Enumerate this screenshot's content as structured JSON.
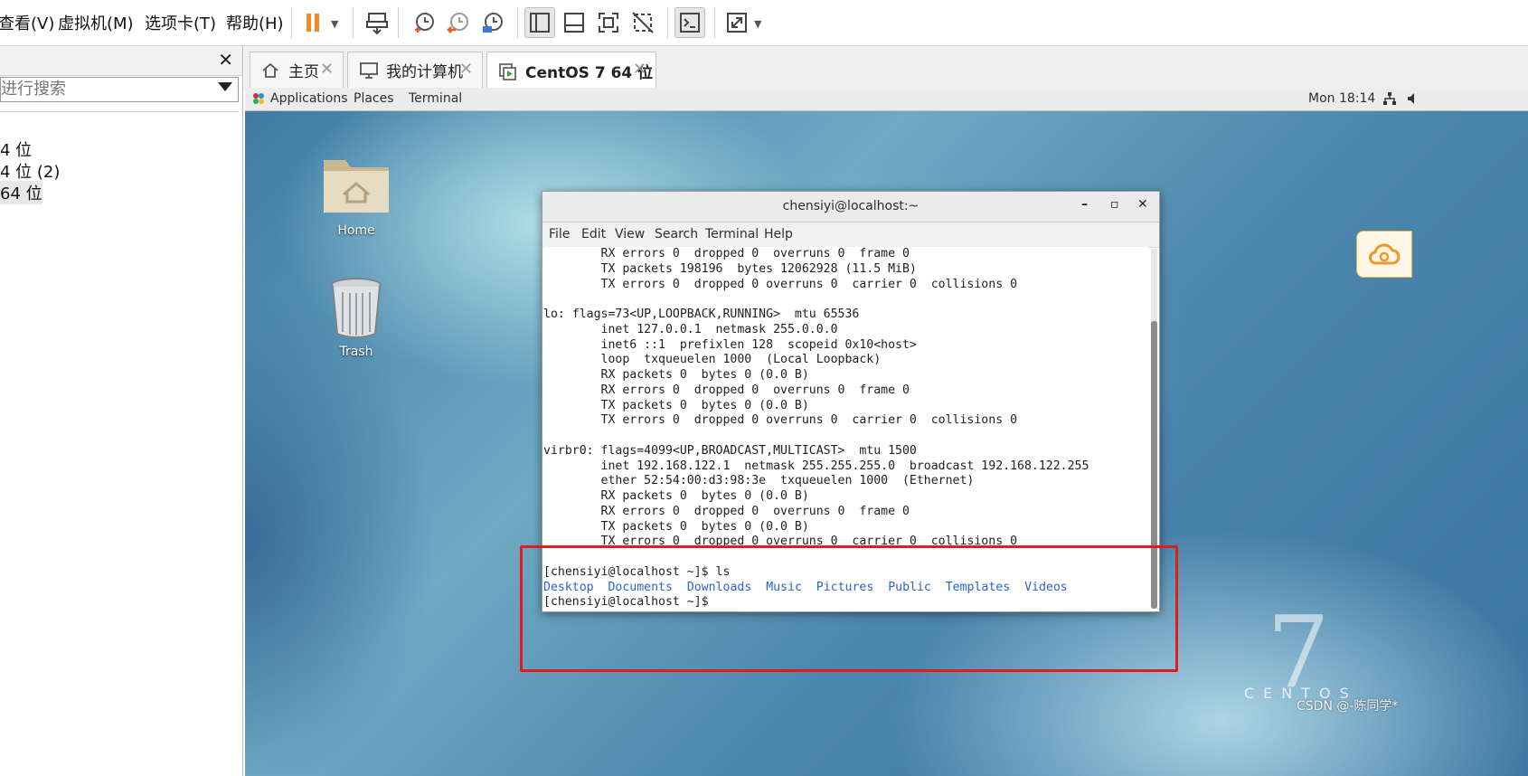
{
  "menubar": {
    "items": [
      "查看(V)",
      "虚拟机(M)",
      "选项卡(T)",
      "帮助(H)"
    ]
  },
  "toolbar": {
    "icons": [
      "pause-icon",
      "send-keys-icon",
      "snapshot-icon",
      "revert-snapshot-icon",
      "snapshot-manager-icon",
      "library-view-icon",
      "thumbnail-view-icon",
      "fullscreen-icon",
      "unity-icon",
      "console-icon",
      "stretch-icon"
    ]
  },
  "library": {
    "search_placeholder": "进行搜索",
    "items": [
      "4 位",
      "4 位 (2)",
      "64 位"
    ]
  },
  "tabs": [
    {
      "label": "主页"
    },
    {
      "label": "我的计算机"
    },
    {
      "label": "CentOS 7 64 位"
    }
  ],
  "guest": {
    "topbar": {
      "applications": "Applications",
      "places": "Places",
      "terminal": "Terminal",
      "clock": "Mon 18:14"
    },
    "desktop_icons": [
      {
        "label": "Home"
      },
      {
        "label": "Trash"
      }
    ],
    "terminal": {
      "title": "chensiyi@localhost:~",
      "menu": [
        "File",
        "Edit",
        "View",
        "Search",
        "Terminal",
        "Help"
      ],
      "lines": [
        "        RX errors 0  dropped 0  overruns 0  frame 0",
        "        TX packets 198196  bytes 12062928 (11.5 MiB)",
        "        TX errors 0  dropped 0 overruns 0  carrier 0  collisions 0",
        "",
        "lo: flags=73<UP,LOOPBACK,RUNNING>  mtu 65536",
        "        inet 127.0.0.1  netmask 255.0.0.0",
        "        inet6 ::1  prefixlen 128  scopeid 0x10<host>",
        "        loop  txqueuelen 1000  (Local Loopback)",
        "        RX packets 0  bytes 0 (0.0 B)",
        "        RX errors 0  dropped 0  overruns 0  frame 0",
        "        TX packets 0  bytes 0 (0.0 B)",
        "        TX errors 0  dropped 0 overruns 0  carrier 0  collisions 0",
        "",
        "virbr0: flags=4099<UP,BROADCAST,MULTICAST>  mtu 1500",
        "        inet 192.168.122.1  netmask 255.255.255.0  broadcast 192.168.122.255",
        "        ether 52:54:00:d3:98:3e  txqueuelen 1000  (Ethernet)",
        "        RX packets 0  bytes 0 (0.0 B)",
        "        RX errors 0  dropped 0  overruns 0  frame 0",
        "        TX packets 0  bytes 0 (0.0 B)",
        "        TX errors 0  dropped 0 overruns 0  carrier 0  collisions 0",
        "",
        "[chensiyi@localhost ~]$ ls"
      ],
      "ls_output": [
        "Desktop",
        "Documents",
        "Downloads",
        "Music",
        "Pictures",
        "Public",
        "Templates",
        "Videos"
      ],
      "prompt": "[chensiyi@localhost ~]$"
    },
    "brand_numeral": "7",
    "brand_word": "CENTOS"
  },
  "watermark": "CSDN @-陈同学*",
  "colors": {
    "highlight_box": "#e41b1b",
    "directory": "#2a63cf",
    "pause": "#f08a24"
  }
}
